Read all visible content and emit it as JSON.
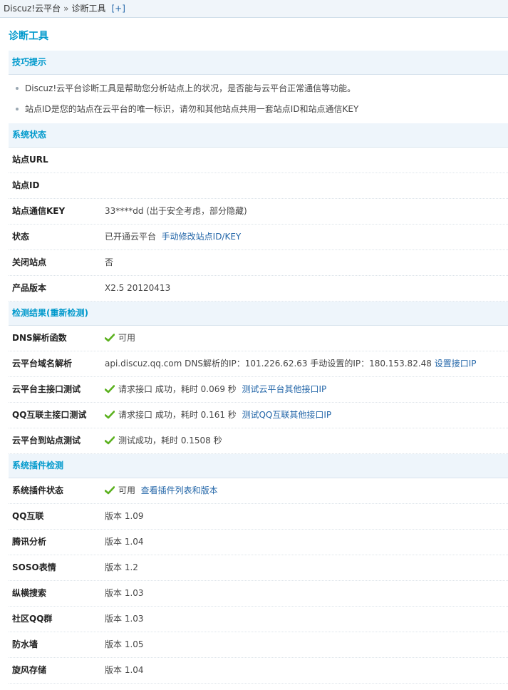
{
  "breadcrumb": {
    "root": "Discuz!云平台",
    "sep": "»",
    "current": "诊断工具",
    "plus": "[+]"
  },
  "page_title": "诊断工具",
  "tips": {
    "header": "技巧提示",
    "items": [
      "Discuz!云平台诊断工具是帮助您分析站点上的状况，是否能与云平台正常通信等功能。",
      "站点ID是您的站点在云平台的唯一标识，请勿和其他站点共用一套站点ID和站点通信KEY"
    ]
  },
  "system_status": {
    "header": "系统状态",
    "rows": {
      "site_url": {
        "label": "站点URL",
        "value": ""
      },
      "site_id": {
        "label": "站点ID",
        "value": ""
      },
      "site_key": {
        "label": "站点通信KEY",
        "value": "33****dd (出于安全考虑，部分隐藏)"
      },
      "status": {
        "label": "状态",
        "value": "已开通云平台",
        "link": "手动修改站点ID/KEY"
      },
      "closed": {
        "label": "关闭站点",
        "value": "否"
      },
      "version": {
        "label": "产品版本",
        "value": "X2.5 20120413"
      }
    }
  },
  "detect": {
    "header_prefix": "检测结果(",
    "header_link": "重新检测",
    "header_suffix": ")",
    "rows": {
      "dns": {
        "label": "DNS解析函数",
        "value": "可用"
      },
      "domain": {
        "label": "云平台域名解析",
        "value": "api.discuz.qq.com DNS解析的IP：101.226.62.63 手动设置的IP：180.153.82.48",
        "link": "设置接口IP"
      },
      "cloud_api": {
        "label": "云平台主接口测试",
        "value": "请求接口  成功，耗时  0.069 秒",
        "link": "测试云平台其他接口IP"
      },
      "qq_api": {
        "label": "QQ互联主接口测试",
        "value": "请求接口  成功，耗时  0.161 秒",
        "link": "测试QQ互联其他接口IP"
      },
      "site_test": {
        "label": "云平台到站点测试",
        "value": "测试成功，耗时  0.1508 秒"
      }
    }
  },
  "plugins": {
    "header": "系统插件检测",
    "status_row": {
      "label": "系统插件状态",
      "value": "可用",
      "link": "查看插件列表和版本"
    },
    "items": [
      {
        "label": "QQ互联",
        "value": "版本  1.09"
      },
      {
        "label": "腾讯分析",
        "value": "版本  1.04"
      },
      {
        "label": "SOSO表情",
        "value": "版本  1.2"
      },
      {
        "label": "纵横搜索",
        "value": "版本  1.03"
      },
      {
        "label": "社区QQ群",
        "value": "版本  1.03"
      },
      {
        "label": "防水墙",
        "value": "版本  1.05"
      },
      {
        "label": "旋风存储",
        "value": "版本  1.04"
      }
    ]
  },
  "colors": {
    "accent": "#0099cc",
    "link": "#2366a8",
    "ok": "#5bb11e",
    "section_bg": "#eef5fb"
  },
  "icons": {
    "ok": "check-icon"
  }
}
